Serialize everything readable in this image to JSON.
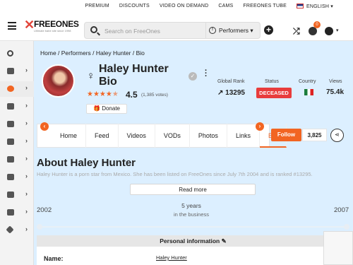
{
  "topbar": {
    "premium": "PREMIUM",
    "discounts": "DISCOUNTS",
    "vod": "VIDEO ON DEMAND",
    "cams": "CAMS",
    "tube": "FREEONES TUBE",
    "lang": "ENGLISH"
  },
  "header": {
    "logo": "FREEONES",
    "tagline": "Ultimate babe site since 1998",
    "search_placeholder": "Search on FreeOnes",
    "scope": "Performers",
    "coins_badge": "0"
  },
  "sidebar": {
    "icons": [
      "search-icon",
      "new-icon",
      "bio-icon",
      "photos-icon",
      "links-icon",
      "videos-icon",
      "vod-icon",
      "cams-icon",
      "games-icon",
      "chat-icon",
      "diamond-icon"
    ]
  },
  "breadcrumb": "Home / Performers / Haley Hunter / Bio",
  "profile": {
    "name": "Haley Hunter Bio",
    "rating": "4.5",
    "votes": "(1,385 votes)",
    "donate": "Donate"
  },
  "stats": {
    "rank_label": "Global Rank",
    "rank": "13295",
    "status_label": "Status",
    "status": "DECEASED",
    "country_label": "Country",
    "views_label": "Views",
    "views": "75.4k"
  },
  "tabs": [
    "Home",
    "Feed",
    "Videos",
    "VODs",
    "Photos",
    "Links",
    "Bio"
  ],
  "follow": {
    "label": "Follow",
    "count": "3,825"
  },
  "about": {
    "title": "About Haley Hunter",
    "text": "Haley Hunter is a porn star from Mexico. She has been listed on FreeOnes since July 7th 2004 and is ranked #13295.",
    "read_more": "Read more"
  },
  "career": {
    "start": "2002",
    "end": "2007",
    "years": "5 years",
    "sub": "in the business"
  },
  "personal": {
    "title": "Personal information",
    "name_label": "Name:",
    "name_value": "Haley Hunter"
  }
}
